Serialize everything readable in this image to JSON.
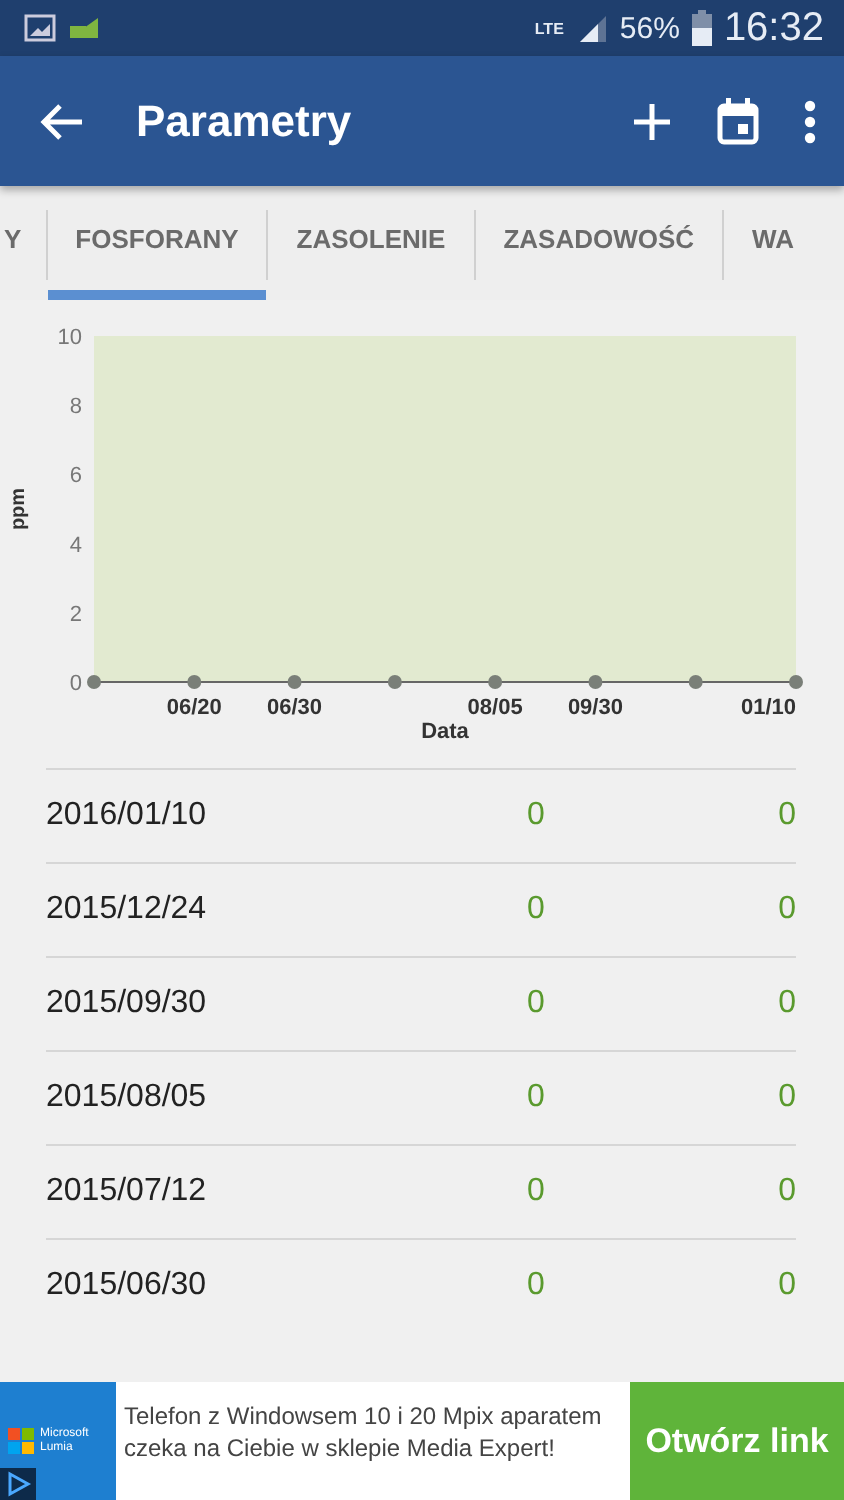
{
  "status_bar": {
    "network": "LTE",
    "battery": "56%",
    "time": "16:32"
  },
  "app_bar": {
    "title": "Parametry"
  },
  "tabs": [
    {
      "label": "Y",
      "selected": false
    },
    {
      "label": "FOSFORANY",
      "selected": true
    },
    {
      "label": "ZASOLENIE",
      "selected": false
    },
    {
      "label": "ZASADOWOŚĆ",
      "selected": false
    },
    {
      "label": "WA",
      "selected": false
    }
  ],
  "chart": {
    "chart_data": {
      "type": "scatter",
      "xlabel": "Data",
      "ylabel": "ppm",
      "categories": [
        null,
        "06/20",
        "06/30",
        null,
        "08/05",
        "09/30",
        null,
        "01/10"
      ],
      "series": [
        {
          "color": "#7a7f78",
          "values": [
            0,
            0,
            0,
            0,
            0,
            0,
            0,
            0
          ]
        }
      ],
      "ylim": [
        0,
        10
      ],
      "yticks": [
        0,
        2,
        4,
        6,
        8,
        10
      ]
    }
  },
  "rows": [
    {
      "date": "2016/01/10",
      "value_1": "0",
      "value_2": "0"
    },
    {
      "date": "2015/12/24",
      "value_1": "0",
      "value_2": "0"
    },
    {
      "date": "2015/09/30",
      "value_1": "0",
      "value_2": "0"
    },
    {
      "date": "2015/08/05",
      "value_1": "0",
      "value_2": "0"
    },
    {
      "date": "2015/07/12",
      "value_1": "0",
      "value_2": "0"
    },
    {
      "date": "2015/06/30",
      "value_1": "0",
      "value_2": "0"
    }
  ],
  "ad": {
    "brand": [
      "Microsoft",
      "Lumia"
    ],
    "text": "Telefon z Windowsem 10 i 20 Mpix aparatem czeka na Ciebie w sklepie Media Expert!",
    "button": "Otwórz link"
  }
}
